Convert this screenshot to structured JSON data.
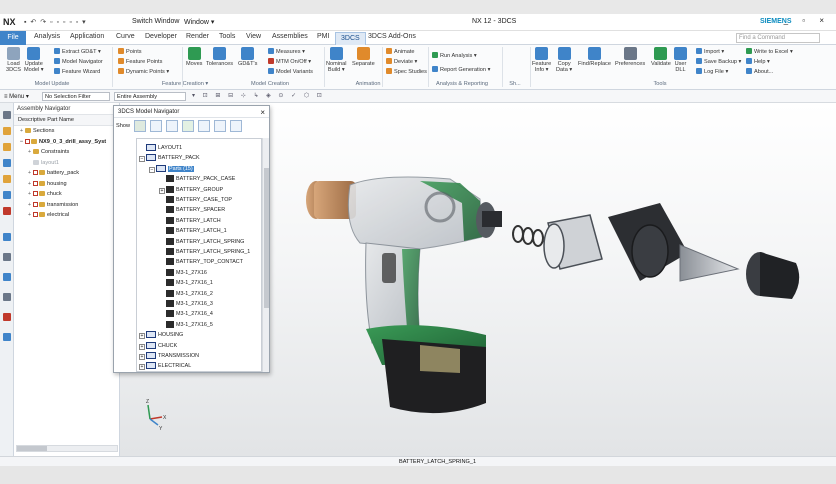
{
  "window": {
    "app_logo": "NX",
    "quick_access": "▪ ↶ ↷ ▫ ▫ ▫ ▫ ▫ ▾",
    "switch_window": "Switch Window",
    "window_menu": "Window ▾",
    "title": "NX 12 - 3DCS",
    "brand": "SIEMENS",
    "controls": "_ ▫ ×"
  },
  "tabs": [
    {
      "label": "File",
      "kind": "file"
    },
    {
      "label": "Analysis"
    },
    {
      "label": "Application"
    },
    {
      "label": "Curve"
    },
    {
      "label": "Developer"
    },
    {
      "label": "Render"
    },
    {
      "label": "Tools"
    },
    {
      "label": "View"
    },
    {
      "label": "Assemblies"
    },
    {
      "label": "PMI"
    },
    {
      "label": "3DCS",
      "active": true
    },
    {
      "label": "3DCS Add-Ons"
    }
  ],
  "find_command": {
    "placeholder": "Find a Command"
  },
  "ribbon": {
    "big": [
      {
        "label": "Load\n3DCS",
        "color": "#8ea4bd"
      },
      {
        "label": "Update\nModel ▾",
        "color": "#3f84c9"
      },
      {
        "label": "Moves",
        "color": "#2e9a52"
      },
      {
        "label": "Tolerances",
        "color": "#3f84c9"
      },
      {
        "label": "GD&T's",
        "color": "#3f84c9"
      },
      {
        "label": "Nominal\nBuild ▾",
        "color": "#3f84c9"
      },
      {
        "label": "Separate",
        "color": "#e08a2b"
      },
      {
        "label": "Feature\nInfo ▾",
        "color": "#3f84c9"
      },
      {
        "label": "Copy\nData ▾",
        "color": "#3f84c9"
      },
      {
        "label": "Find/Replace",
        "color": "#3f84c9"
      },
      {
        "label": "Preferences",
        "color": "#6b7788"
      },
      {
        "label": "Validate",
        "color": "#2e9a52"
      },
      {
        "label": "User\nDLL",
        "color": "#3f84c9"
      }
    ],
    "small": [
      {
        "label": "Extract GD&T ▾",
        "color": "#3f84c9"
      },
      {
        "label": "Model Navigator",
        "color": "#3f84c9"
      },
      {
        "label": "Feature Wizard",
        "color": "#3f84c9"
      },
      {
        "label": "Points",
        "color": "#e08a2b"
      },
      {
        "label": "Feature Points",
        "color": "#e08a2b"
      },
      {
        "label": "Dynamic Points ▾",
        "color": "#e08a2b"
      },
      {
        "label": "Measures ▾",
        "color": "#3f84c9"
      },
      {
        "label": "MTM On/Off ▾",
        "color": "#c0392b"
      },
      {
        "label": "Model Variants",
        "color": "#3f84c9"
      },
      {
        "label": "Animate",
        "color": "#e08a2b"
      },
      {
        "label": "Deviate ▾",
        "color": "#e08a2b"
      },
      {
        "label": "Spec Studies",
        "color": "#e08a2b"
      },
      {
        "label": "Run Analysis ▾",
        "color": "#2e9a52"
      },
      {
        "label": "Report Generation ▾",
        "color": "#3f84c9"
      },
      {
        "label": "Import ▾",
        "color": "#3f84c9"
      },
      {
        "label": "Save Backup ▾",
        "color": "#3f84c9"
      },
      {
        "label": "Log File ▾",
        "color": "#3f84c9"
      },
      {
        "label": "Write to Excel ▾",
        "color": "#2e9a52"
      },
      {
        "label": "Help ▾",
        "color": "#3f84c9"
      },
      {
        "label": "About...",
        "color": "#3f84c9"
      }
    ],
    "groups": [
      "Model Update",
      "Feature Creation ▾",
      "Model Creation",
      "Animation",
      "Analysis & Reporting",
      "Sh...",
      "Tools"
    ]
  },
  "selbar": {
    "menu": "≡ Menu ▾",
    "filter": "No Selection Filter",
    "scope": "Entire Assembly",
    "tools": "▾ ⊡ ⊞ ⊟ ⊹ ↳ ◈ ⊙ ✓ ⬡ ⊡"
  },
  "assembly_nav": {
    "title": "Assembly Navigator",
    "col_header": "Descriptive Part Name",
    "rows": [
      {
        "label": "Sections",
        "toggle": "+",
        "folder": true
      },
      {
        "label": "NX9_0_3_drill_assy_Syst",
        "toggle": "−",
        "check": true,
        "bold": true
      },
      {
        "label": "Constraints",
        "toggle": "+",
        "folder": true,
        "indent": 1
      },
      {
        "label": "layout1",
        "indent": 1,
        "grey": true
      },
      {
        "label": "battery_pack",
        "toggle": "+",
        "check": true,
        "indent": 1
      },
      {
        "label": "housing",
        "toggle": "+",
        "check": true,
        "indent": 1
      },
      {
        "label": "chuck",
        "toggle": "+",
        "check": true,
        "indent": 1
      },
      {
        "label": "transmission",
        "toggle": "+",
        "check": true,
        "indent": 1
      },
      {
        "label": "electrical",
        "toggle": "+",
        "check": true,
        "indent": 1
      }
    ]
  },
  "model_nav": {
    "title": "3DCS Model Navigator",
    "show_label": "Show",
    "close": "×",
    "nodes": [
      {
        "label": "LAYOUT1",
        "level": 1,
        "kind": "box"
      },
      {
        "label": "BATTERY_PACK",
        "level": 1,
        "kind": "box",
        "pm": "−"
      },
      {
        "label": "Parts (15)",
        "level": 2,
        "kind": "box",
        "pm": "−",
        "selected": true
      },
      {
        "label": "BATTERY_PACK_CASE",
        "level": 3,
        "kind": "part"
      },
      {
        "label": "BATTERY_GROUP",
        "level": 3,
        "kind": "part",
        "pm": "+"
      },
      {
        "label": "BATTERY_CASE_TOP",
        "level": 3,
        "kind": "part"
      },
      {
        "label": "BATTERY_SPACER",
        "level": 3,
        "kind": "part"
      },
      {
        "label": "BATTERY_LATCH",
        "level": 3,
        "kind": "part"
      },
      {
        "label": "BATTERY_LATCH_1",
        "level": 3,
        "kind": "part"
      },
      {
        "label": "BATTERY_LATCH_SPRING",
        "level": 3,
        "kind": "part"
      },
      {
        "label": "BATTERY_LATCH_SPRING_1",
        "level": 3,
        "kind": "part"
      },
      {
        "label": "BATTERY_TOP_CONTACT",
        "level": 3,
        "kind": "part"
      },
      {
        "label": "M3-1_27X16",
        "level": 3,
        "kind": "part"
      },
      {
        "label": "M3-1_27X16_1",
        "level": 3,
        "kind": "part"
      },
      {
        "label": "M3-1_27X16_2",
        "level": 3,
        "kind": "part"
      },
      {
        "label": "M3-1_27X16_3",
        "level": 3,
        "kind": "part"
      },
      {
        "label": "M3-1_27X16_4",
        "level": 3,
        "kind": "part"
      },
      {
        "label": "M3-1_27X16_5",
        "level": 3,
        "kind": "part"
      },
      {
        "label": "HOUSING",
        "level": 1,
        "kind": "box",
        "pm": "+"
      },
      {
        "label": "CHUCK",
        "level": 1,
        "kind": "box",
        "pm": "+"
      },
      {
        "label": "TRANSMISSION",
        "level": 1,
        "kind": "box",
        "pm": "+"
      },
      {
        "label": "ELECTRICAL",
        "level": 1,
        "kind": "box",
        "pm": "+"
      }
    ]
  },
  "viewport": {
    "triad_x": "X",
    "triad_y": "Y",
    "triad_z": "Z"
  },
  "status": {
    "text": "BATTERY_LATCH_SPRING_1"
  }
}
